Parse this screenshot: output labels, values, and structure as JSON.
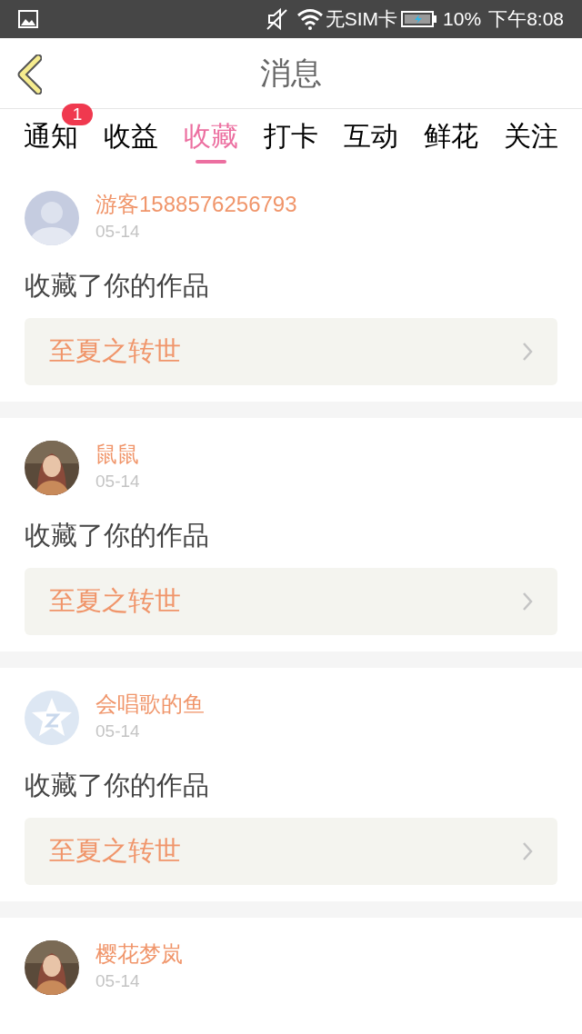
{
  "status_bar": {
    "sim": "无SIM卡",
    "battery": "10%",
    "time": "下午8:08"
  },
  "header": {
    "title": "消息"
  },
  "tabs": [
    {
      "label": "通知",
      "selected": false,
      "badge": "1"
    },
    {
      "label": "收益",
      "selected": false
    },
    {
      "label": "收藏",
      "selected": true
    },
    {
      "label": "打卡",
      "selected": false
    },
    {
      "label": "互动",
      "selected": false
    },
    {
      "label": "鲜花",
      "selected": false
    },
    {
      "label": "关注",
      "selected": false
    }
  ],
  "messages": [
    {
      "kind": "silhouette",
      "user": "游客1588576256793",
      "date": "05-14",
      "action": "收藏了你的作品",
      "work": "至夏之转世"
    },
    {
      "kind": "picture",
      "user": "鼠鼠",
      "date": "05-14",
      "action": "收藏了你的作品",
      "work": "至夏之转世"
    },
    {
      "kind": "star",
      "user": "会唱歌的鱼",
      "date": "05-14",
      "action": "收藏了你的作品",
      "work": "至夏之转世"
    },
    {
      "kind": "picture",
      "user": "樱花梦岚",
      "date": "05-14"
    }
  ]
}
